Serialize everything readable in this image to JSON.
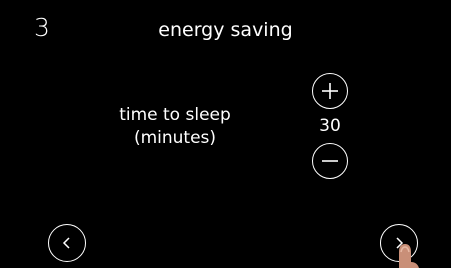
{
  "header": {
    "step_number": "3",
    "title": "energy saving"
  },
  "setting": {
    "label_line1": "time to sleep",
    "label_line2": "(minutes)",
    "value": "30"
  },
  "controls": {
    "increase_icon": "plus-icon",
    "decrease_icon": "minus-icon",
    "back_icon": "chevron-left-icon",
    "next_icon": "chevron-right-icon"
  },
  "colors": {
    "background": "#000000",
    "foreground": "#ffffff"
  }
}
